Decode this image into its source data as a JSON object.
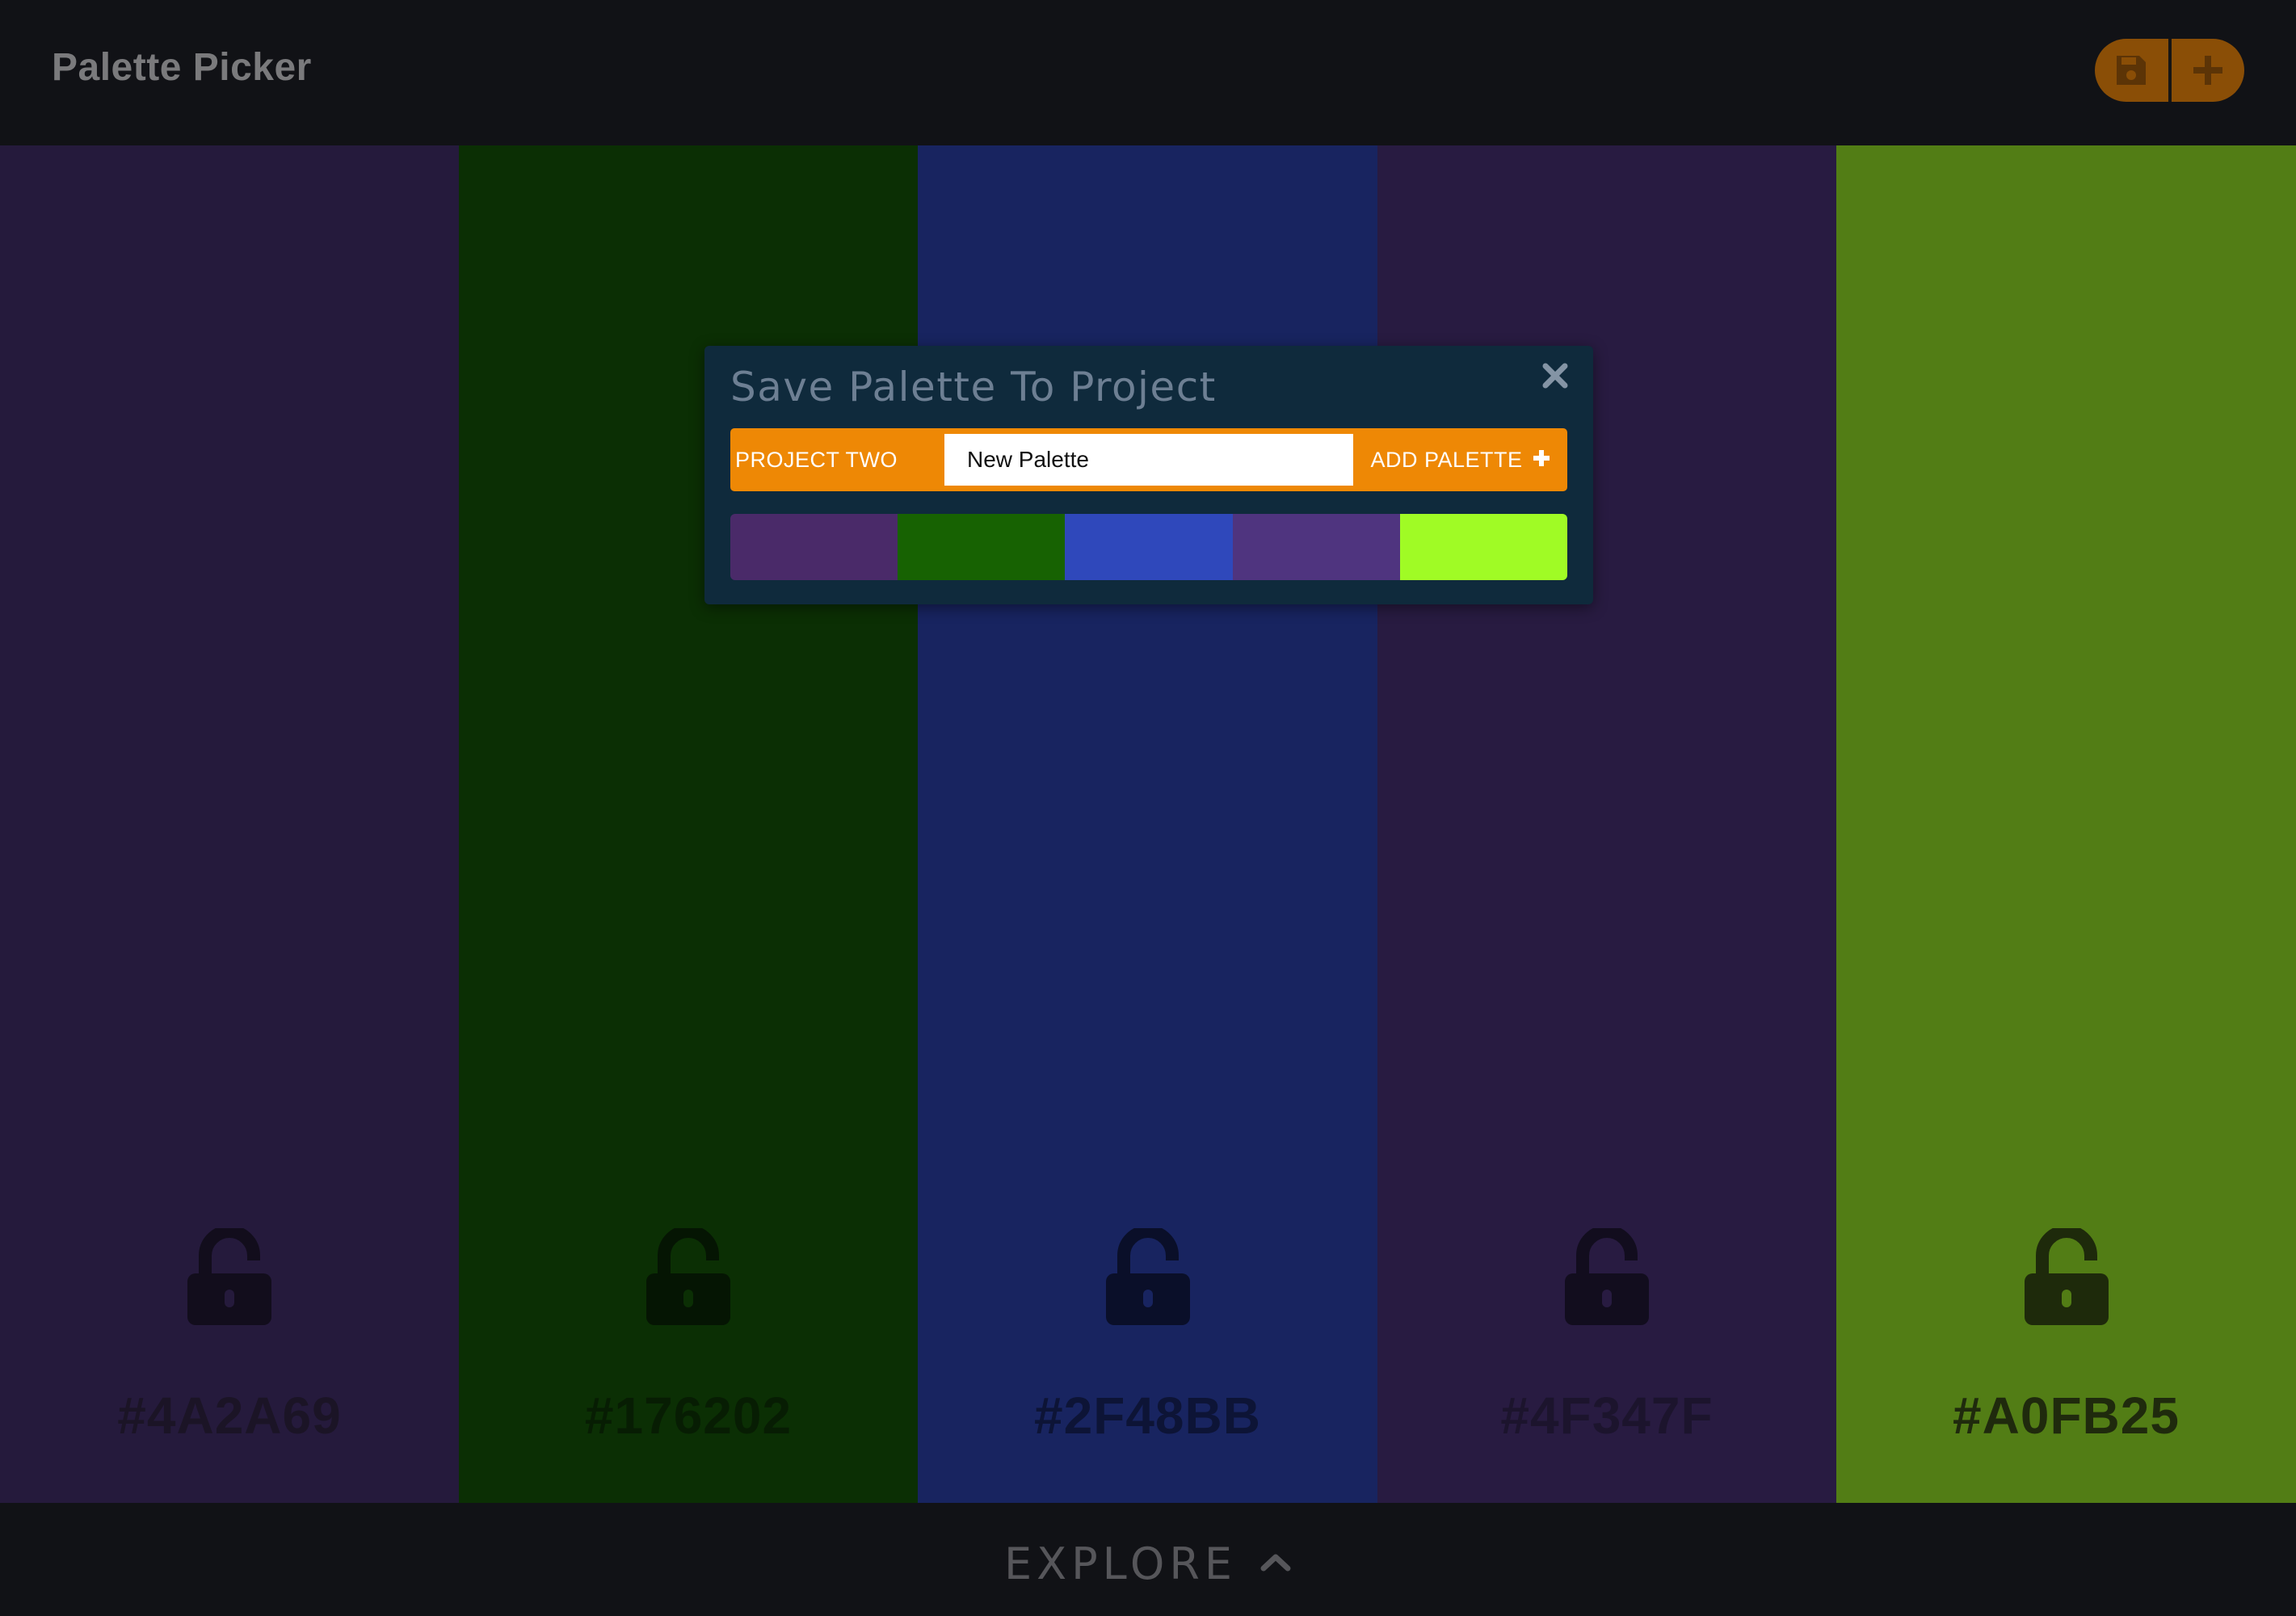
{
  "header": {
    "title": "Palette Picker",
    "save_icon": "floppy-disk-icon",
    "add_icon": "plus-icon",
    "accent": "#8A4E06"
  },
  "palette": {
    "columns": [
      {
        "hex": "#4A2A69",
        "bg": "#251A3C",
        "text_color": "#1B1426",
        "lock_color": "#120D1C",
        "locked": false
      },
      {
        "hex": "#176202",
        "bg": "#0B2F04",
        "text_color": "#071D03",
        "lock_color": "#051503",
        "locked": false
      },
      {
        "hex": "#2F48BB",
        "bg": "#182460",
        "text_color": "#0D1436",
        "lock_color": "#0A0F29",
        "locked": false
      },
      {
        "hex": "#4F347F",
        "bg": "#281B41",
        "text_color": "#1C142D",
        "lock_color": "#120D1E",
        "locked": false
      },
      {
        "hex": "#A0FB25",
        "bg": "#527D15",
        "text_color": "#1F2A0D",
        "lock_color": "#1E2A0B",
        "locked": false
      }
    ]
  },
  "modal": {
    "title": "Save Palette To Project",
    "project_selected": "PROJECT TWO",
    "palette_name_value": "New Palette",
    "add_button_label": "ADD PALETTE",
    "add_button_icon": "plus-icon",
    "close_icon": "close-icon",
    "accent": "#EE8805",
    "preview_colors": [
      "#4A2A69",
      "#176202",
      "#2F48BB",
      "#4F347F",
      "#A0FB25"
    ]
  },
  "footer": {
    "explore_label": "EXPLORE",
    "explore_icon": "chevron-up-icon"
  }
}
